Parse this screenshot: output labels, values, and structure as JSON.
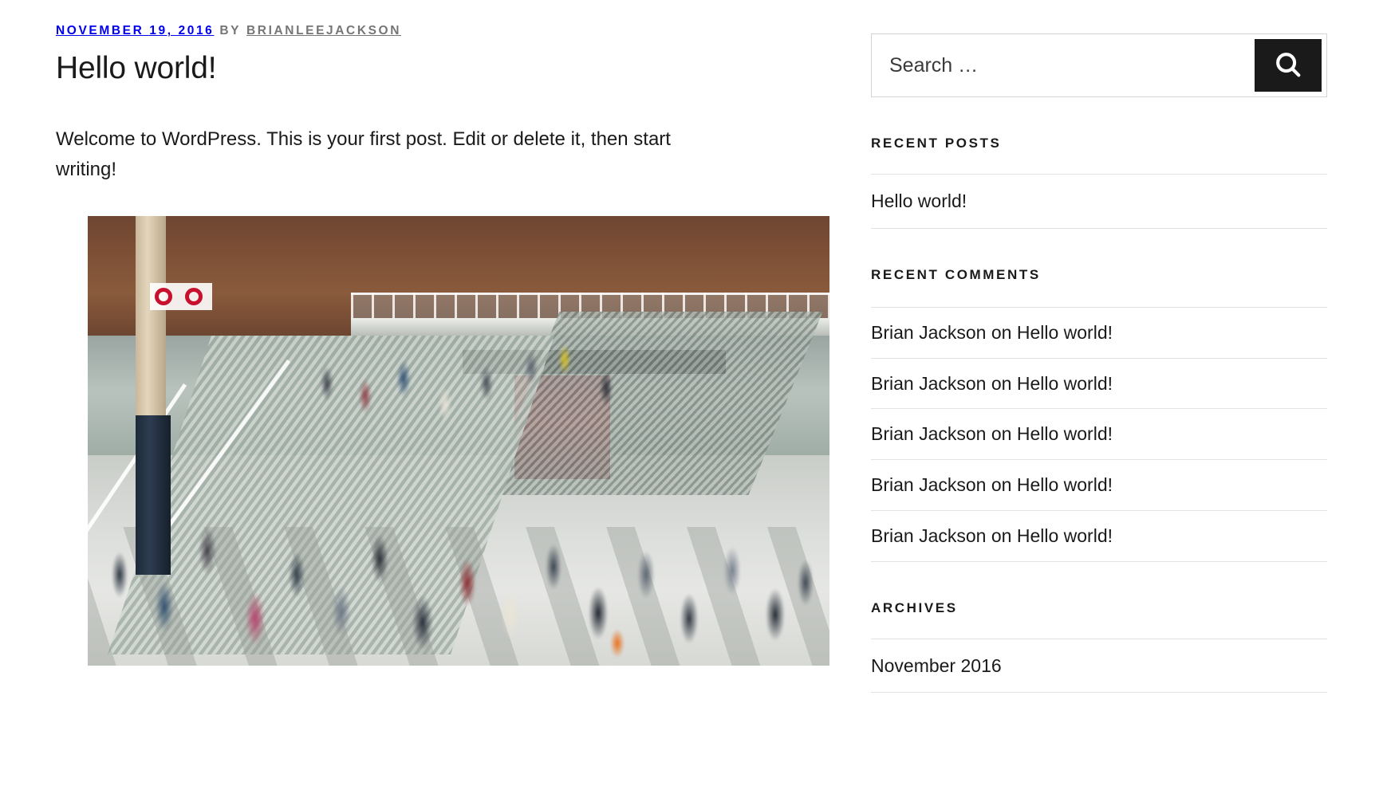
{
  "post": {
    "meta_date": "November 19, 2016",
    "meta_by": "by",
    "meta_author": "brianleejackson",
    "title": "Hello world!",
    "body": "Welcome to WordPress. This is your first post. Edit or delete it, then start writing!",
    "featured_image_alt": "Crowded London Underground station concourse with escalators, staircases and motion-blurred commuters"
  },
  "sidebar": {
    "search": {
      "placeholder": "Search …",
      "value": "",
      "button_icon": "search-icon",
      "button_color": "#1a1a1a"
    },
    "recent_posts": {
      "title": "Recent Posts",
      "items": [
        {
          "label": "Hello world!"
        }
      ]
    },
    "recent_comments": {
      "title": "Recent Comments",
      "items": [
        {
          "author": "Brian Jackson",
          "sep": "on",
          "post": "Hello world!"
        },
        {
          "author": "Brian Jackson",
          "sep": "on",
          "post": "Hello world!"
        },
        {
          "author": "Brian Jackson",
          "sep": "on",
          "post": "Hello world!"
        },
        {
          "author": "Brian Jackson",
          "sep": "on",
          "post": "Hello world!"
        },
        {
          "author": "Brian Jackson",
          "sep": "on",
          "post": "Hello world!"
        }
      ]
    },
    "archives": {
      "title": "Archives",
      "items": [
        {
          "label": "November 2016"
        }
      ]
    }
  },
  "colors": {
    "text": "#1a1a1a",
    "meta": "#767676",
    "rule": "#e3e3e3",
    "button": "#1a1a1a",
    "page_bg": "#ffffff"
  }
}
